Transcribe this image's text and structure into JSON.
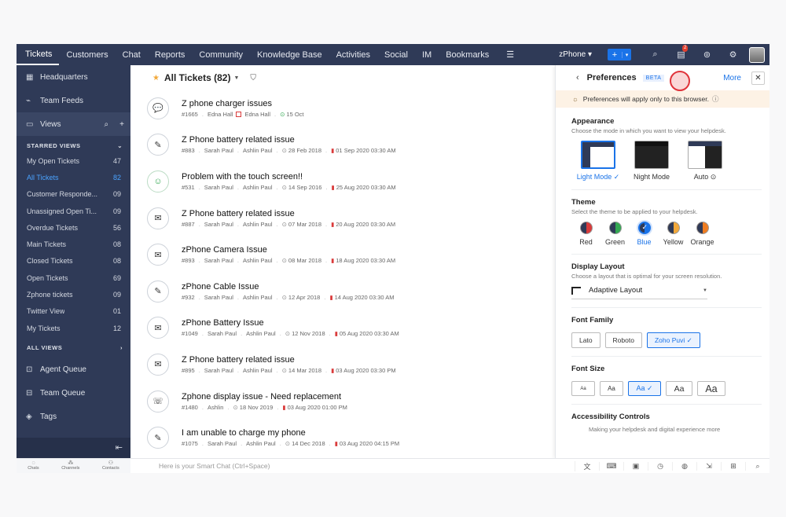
{
  "topnav": {
    "tabs": [
      "Tickets",
      "Customers",
      "Chat",
      "Reports",
      "Community",
      "Knowledge Base",
      "Activities",
      "Social",
      "IM",
      "Bookmarks"
    ],
    "active_tab": "Tickets",
    "department": "zPhone ▾",
    "plus_label": "+",
    "notification_count": "2"
  },
  "sidebar": {
    "items": [
      {
        "label": "Headquarters",
        "icon": "grid-icon"
      },
      {
        "label": "Team Feeds",
        "icon": "feed-icon"
      }
    ],
    "views_label": "Views",
    "starred_label": "STARRED VIEWS",
    "starred_views": [
      {
        "name": "My Open Tickets",
        "count": "47"
      },
      {
        "name": "All Tickets",
        "count": "82",
        "active": true
      },
      {
        "name": "Customer Responde...",
        "count": "09"
      },
      {
        "name": "Unassigned Open Ti...",
        "count": "09"
      },
      {
        "name": "Overdue Tickets",
        "count": "56"
      },
      {
        "name": "Main Tickets",
        "count": "08"
      },
      {
        "name": "Closed Tickets",
        "count": "08"
      },
      {
        "name": "Open Tickets",
        "count": "69"
      },
      {
        "name": "Zphone tickets",
        "count": "09"
      },
      {
        "name": "Twitter View",
        "count": "01"
      },
      {
        "name": "My Tickets",
        "count": "12"
      }
    ],
    "all_views_label": "ALL VIEWS",
    "queues": [
      {
        "label": "Agent Queue"
      },
      {
        "label": "Team Queue"
      },
      {
        "label": "Tags"
      }
    ]
  },
  "list": {
    "title": "All Tickets (82)",
    "tickets": [
      {
        "subject": "Z phone charger issues",
        "id": "#1665",
        "contact": "Edna Hall",
        "agent": "Edna Hall",
        "created": "",
        "due": "15 Oct",
        "status": "ok"
      },
      {
        "subject": "Z Phone battery related issue",
        "id": "#883",
        "contact": "Sarah Paul",
        "agent": "Ashlin Paul",
        "created": "28 Feb 2018",
        "due": "01 Sep 2020 03:30 AM",
        "status": "due"
      },
      {
        "subject": "Problem with the touch screen!!",
        "id": "#531",
        "contact": "Sarah Paul",
        "agent": "Ashlin Paul",
        "created": "14 Sep 2016",
        "due": "25 Aug 2020 03:30 AM",
        "status": "due"
      },
      {
        "subject": "Z Phone battery related issue",
        "id": "#887",
        "contact": "Sarah Paul",
        "agent": "Ashlin Paul",
        "created": "07 Mar 2018",
        "due": "20 Aug 2020 03:30 AM",
        "status": "due"
      },
      {
        "subject": "zPhone Camera Issue",
        "id": "#893",
        "contact": "Sarah Paul",
        "agent": "Ashlin Paul",
        "created": "08 Mar 2018",
        "due": "18 Aug 2020 03:30 AM",
        "status": "due"
      },
      {
        "subject": "zPhone Cable Issue",
        "id": "#932",
        "contact": "Sarah Paul",
        "agent": "Ashlin Paul",
        "created": "12 Apr 2018",
        "due": "14 Aug 2020 03:30 AM",
        "status": "due"
      },
      {
        "subject": "zPhone Battery Issue",
        "id": "#1049",
        "contact": "Sarah Paul",
        "agent": "Ashlin Paul",
        "created": "12 Nov 2018",
        "due": "05 Aug 2020 03:30 AM",
        "status": "due"
      },
      {
        "subject": "Z Phone battery related issue",
        "id": "#895",
        "contact": "Sarah Paul",
        "agent": "Ashlin Paul",
        "created": "14 Mar 2018",
        "due": "03 Aug 2020 03:30 PM",
        "status": "due"
      },
      {
        "subject": "Zphone display issue - Need replacement",
        "id": "#1480",
        "contact": "Ashlin",
        "agent": "",
        "created": "18 Nov 2019",
        "due": "03 Aug 2020 01:00 PM",
        "status": "due"
      },
      {
        "subject": "I am unable to charge my phone",
        "id": "#1075",
        "contact": "Sarah Paul",
        "agent": "Ashlin Paul",
        "created": "14 Dec 2018",
        "due": "03 Aug 2020 04:15 PM",
        "status": "due"
      }
    ]
  },
  "panel": {
    "title": "Preferences",
    "beta": "BETA",
    "more": "More",
    "note": "Preferences will apply only to this browser.",
    "appearance": {
      "title": "Appearance",
      "sub": "Choose the mode in which you want to view your helpdesk.",
      "modes": [
        "Light Mode ✓",
        "Night Mode",
        "Auto ⊙"
      ]
    },
    "theme": {
      "title": "Theme",
      "sub": "Select the theme to be applied to your helpdesk.",
      "options": [
        {
          "name": "Red",
          "color": "#d93b3b"
        },
        {
          "name": "Green",
          "color": "#33a852"
        },
        {
          "name": "Blue",
          "color": "#1a73e8"
        },
        {
          "name": "Yellow",
          "color": "#f2a93b"
        },
        {
          "name": "Orange",
          "color": "#ef7d22"
        }
      ]
    },
    "layout": {
      "title": "Display Layout",
      "sub": "Choose a layout that is optimal for your screen resolution.",
      "value": "Adaptive Layout"
    },
    "font_family": {
      "title": "Font Family",
      "options": [
        "Lato",
        "Roboto",
        "Zoho Puvi ✓"
      ]
    },
    "font_size": {
      "title": "Font Size",
      "options": [
        "Aa",
        "Aa",
        "Aa ✓",
        "Aa",
        "Aa"
      ]
    },
    "accessibility": {
      "title": "Accessibility Controls",
      "sub": "Making your helpdesk and digital experience more"
    }
  },
  "bottombar": {
    "left": [
      "Chats",
      "Channels",
      "Contacts"
    ],
    "smartchat_placeholder": "Here is your Smart Chat (Ctrl+Space)"
  }
}
